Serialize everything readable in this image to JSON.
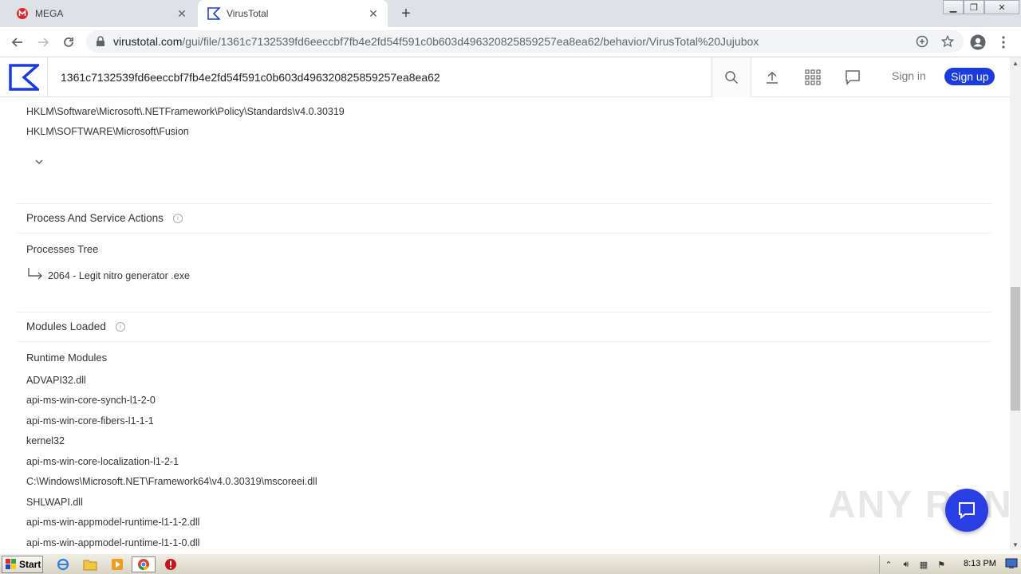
{
  "browser": {
    "tabs": [
      {
        "label": "MEGA",
        "active": false
      },
      {
        "label": "VirusTotal",
        "active": true
      }
    ],
    "url_host": "virustotal.com",
    "url_path": "/gui/file/1361c7132539fd6eeccbf7fb4e2fd54f591c0b603d496320825859257ea8ea62/behavior/VirusTotal%20Jujubox"
  },
  "header": {
    "search_value": "1361c7132539fd6eeccbf7fb4e2fd54f591c0b603d496320825859257ea8ea62",
    "signin_label": "Sign in",
    "signup_label": "Sign up"
  },
  "registry_keys": [
    "HKLM\\Software\\Microsoft\\.NETFramework\\Policy\\Standards\\v4.0.30319",
    "HKLM\\SOFTWARE\\Microsoft\\Fusion"
  ],
  "process_section": {
    "title": "Process And Service Actions",
    "subtitle": "Processes Tree",
    "tree_item": "2064 - Legit nitro generator .exe"
  },
  "modules_section": {
    "title": "Modules Loaded",
    "subtitle": "Runtime Modules",
    "modules": [
      "ADVAPI32.dll",
      "api-ms-win-core-synch-l1-2-0",
      "api-ms-win-core-fibers-l1-1-1",
      "kernel32",
      "api-ms-win-core-localization-l1-2-1",
      "C:\\Windows\\Microsoft.NET\\Framework64\\v4.0.30319\\mscoreei.dll",
      "SHLWAPI.dll",
      "api-ms-win-appmodel-runtime-l1-1-2.dll",
      "api-ms-win-appmodel-runtime-l1-1-0.dll"
    ]
  },
  "watermark": "ANY RUN",
  "taskbar": {
    "start_label": "Start",
    "clock": "8:13 PM"
  },
  "colors": {
    "vt_blue": "#1a3cde",
    "mega_red": "#d9272e"
  }
}
